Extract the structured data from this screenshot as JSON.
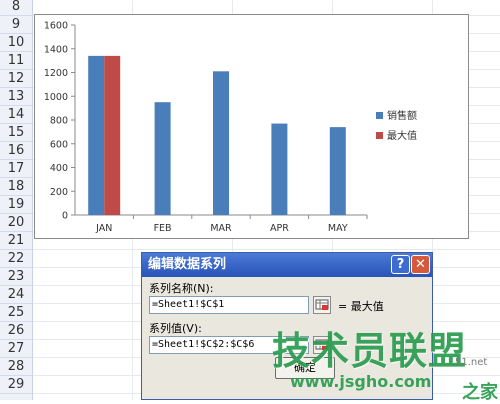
{
  "spreadsheet": {
    "row_numbers": [
      "8",
      "9",
      "10",
      "11",
      "12",
      "13",
      "14",
      "15",
      "16",
      "17",
      "18",
      "19",
      "20",
      "21",
      "22",
      "23",
      "24",
      "25",
      "26",
      "27",
      "28",
      "29"
    ]
  },
  "chart_data": {
    "type": "bar",
    "categories": [
      "JAN",
      "FEB",
      "MAR",
      "APR",
      "MAY"
    ],
    "series": [
      {
        "name": "销售额",
        "values": [
          1340,
          950,
          1210,
          770,
          740
        ],
        "color": "#4a7ebb"
      },
      {
        "name": "最大值",
        "values": [
          1340,
          0,
          0,
          0,
          0
        ],
        "color": "#be4b48"
      }
    ],
    "yticks": [
      0,
      200,
      400,
      600,
      800,
      1000,
      1200,
      1400,
      1600
    ],
    "ylim": [
      0,
      1600
    ],
    "legend": "right"
  },
  "dialog": {
    "title": "编辑数据系列",
    "help_label": "?",
    "close_label": "✕",
    "name_label": "系列名称(N):",
    "name_value": "=Sheet1!$C$1",
    "name_preview": "= 最大值",
    "values_label": "系列值(V):",
    "values_value": "=Sheet1!$C$2:$C$6",
    "ok_label": "确定"
  },
  "watermark": {
    "main": "技术员联盟",
    "url": "www.jsgho.com",
    "suffix": "之家",
    "side": "51.net"
  }
}
